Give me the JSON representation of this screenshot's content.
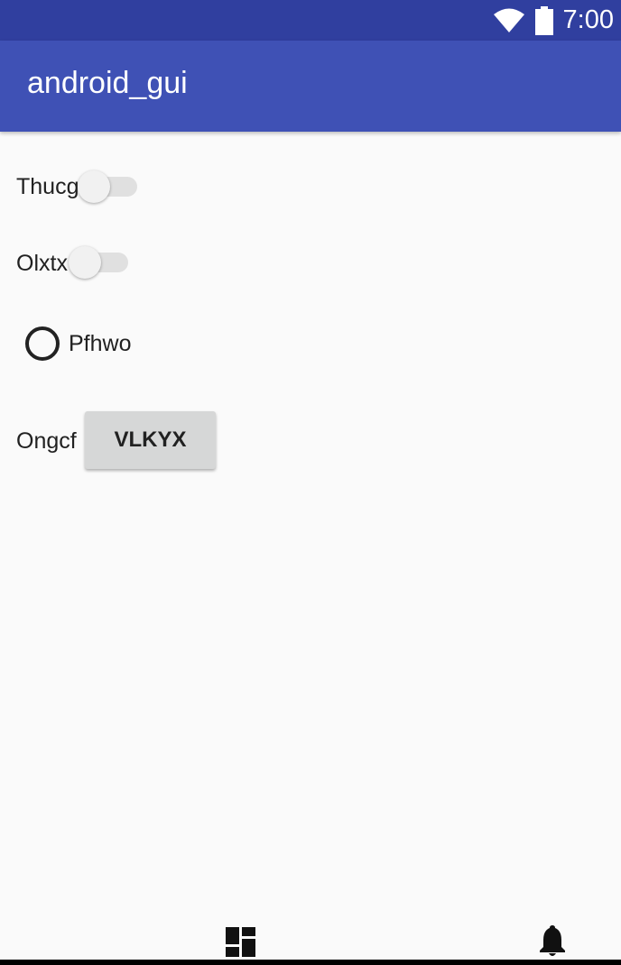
{
  "status_bar": {
    "time": "7:00",
    "icons": [
      "wifi-icon",
      "battery-icon"
    ]
  },
  "app_bar": {
    "title": "android_gui"
  },
  "form": {
    "switch1_label": "Thucg",
    "switch1_on": false,
    "switch2_label": "Olxtx",
    "switch2_on": false,
    "radio_label": "Pfhwo",
    "radio_checked": false,
    "button_row_label": "Ongcf",
    "button_label": "VLKYX"
  },
  "bottom_nav": {
    "icons": [
      "dashboard-icon",
      "notifications-icon"
    ]
  },
  "colors": {
    "status_bar": "#303f9f",
    "app_bar": "#3f51b5",
    "background": "#fafafa",
    "button": "#d6d7d7"
  }
}
